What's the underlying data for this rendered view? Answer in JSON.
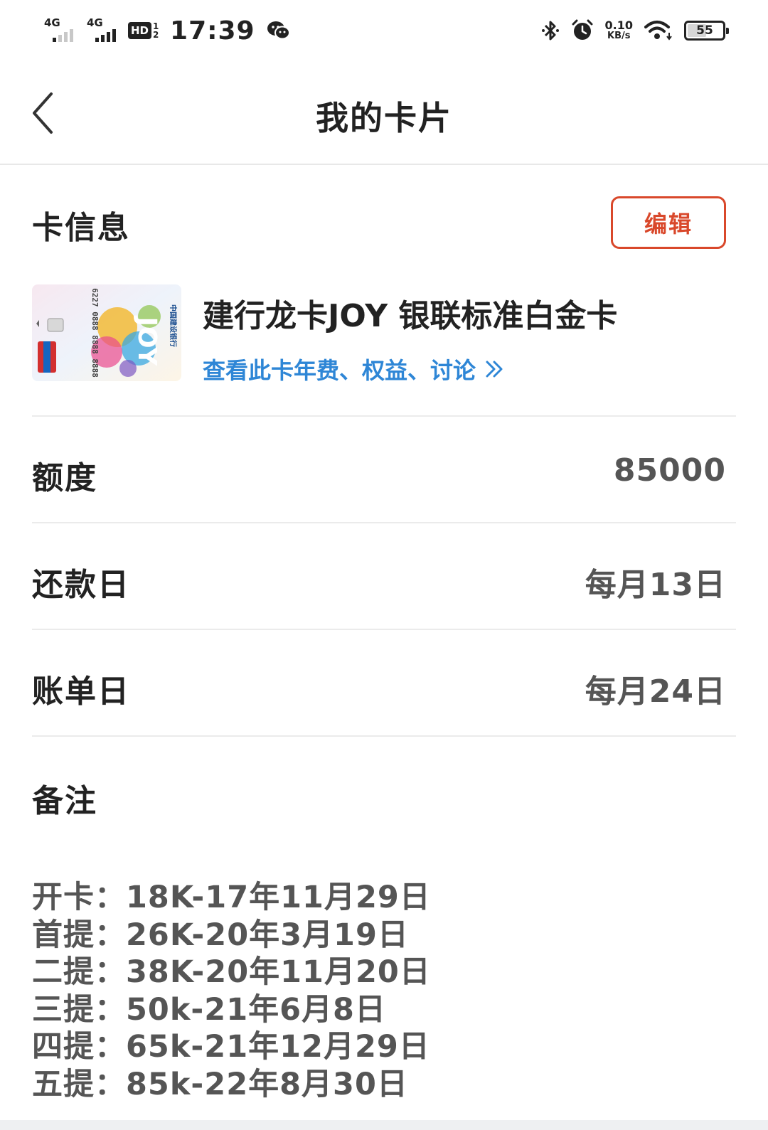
{
  "status_bar": {
    "sim1": "4G",
    "sim2": "4G",
    "hd": "HD",
    "hd_sub": "1 2",
    "time": "17:39",
    "net_speed_value": "0.10",
    "net_speed_unit": "KB/s",
    "battery_level": "55",
    "battery_fraction": 0.55
  },
  "nav": {
    "title": "我的卡片"
  },
  "card_info": {
    "section_title": "卡信息",
    "edit_label": "编辑",
    "card_name": "建行龙卡JOY 银联标准白金卡",
    "card_link": "查看此卡年费、权益、讨论",
    "card_image": {
      "number": "6227 0888 8888 8888",
      "bank": "中国建设银行",
      "logo": "JOY"
    }
  },
  "details": [
    {
      "label": "额度",
      "value": "85000"
    },
    {
      "label": "还款日",
      "value": "每月13日"
    },
    {
      "label": "账单日",
      "value": "每月24日"
    }
  ],
  "notes": {
    "label": "备注",
    "lines": [
      "开卡：18K-17年11月29日",
      "首提：26K-20年3月19日",
      "二提：38K-20年11月20日",
      "三提：50k-21年6月8日",
      "四提：65k-21年12月29日",
      "五提：85k-22年8月30日"
    ]
  },
  "colors": {
    "accent_red": "#d9482b",
    "link_blue": "#2e86d6",
    "divider": "#ebebeb"
  },
  "icons": [
    "wechat-icon",
    "bluetooth-icon",
    "alarm-icon",
    "wifi-icon",
    "back-chevron-icon",
    "double-chevron-right-icon"
  ]
}
